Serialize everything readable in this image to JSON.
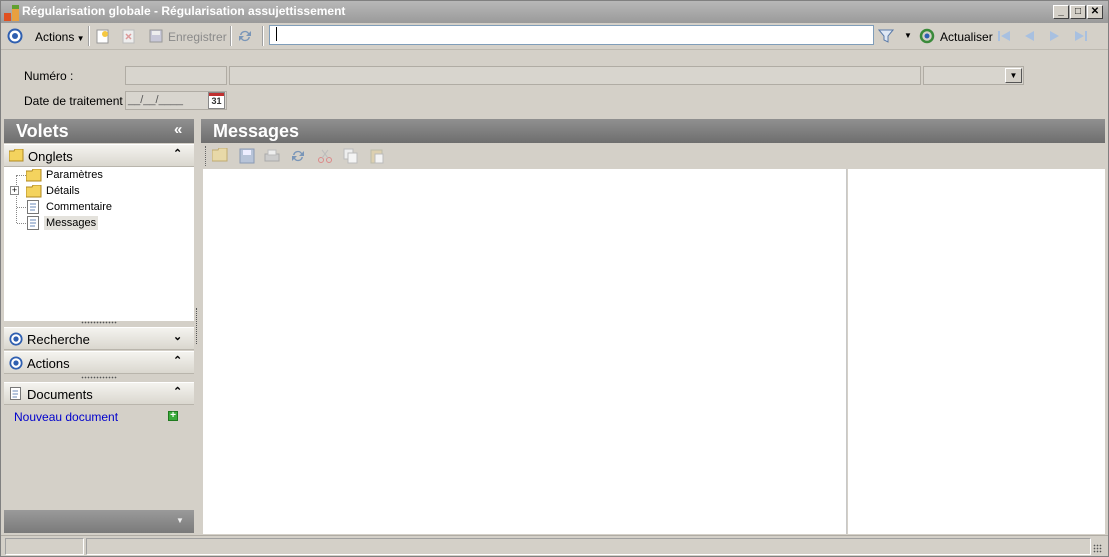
{
  "window": {
    "title": "Régularisation globale - Régularisation assujettissement",
    "controls": [
      "minimize",
      "maximize",
      "close"
    ]
  },
  "toolbar": {
    "actions_label": "Actions",
    "save_label": "Enregistrer",
    "search_value": "",
    "refresh_label": "Actualiser"
  },
  "form": {
    "numero_label": "Numéro :",
    "numero_value": "",
    "numero_desc": "",
    "numero_select": "",
    "date_label": "Date de traitement :",
    "date_placeholder": "__/__/____",
    "calendar_day": "31"
  },
  "left_pane": {
    "title": "Volets",
    "collapse_glyph": "«",
    "onglets": {
      "title": "Onglets",
      "items": [
        {
          "label": "Paramètres",
          "icon": "folder-icon"
        },
        {
          "label": "Détails",
          "icon": "folder-icon",
          "expandable": true
        },
        {
          "label": "Commentaire",
          "icon": "document-icon"
        },
        {
          "label": "Messages",
          "icon": "document-icon",
          "selected": true
        }
      ]
    },
    "recherche": {
      "title": "Recherche"
    },
    "actions": {
      "title": "Actions"
    },
    "documents": {
      "title": "Documents",
      "new_doc_label": "Nouveau document"
    }
  },
  "main_pane": {
    "title": "Messages"
  },
  "colors": {
    "title_bar": "#9a9a9a",
    "pane_header": "#7a7a7a",
    "link": "#0000cc",
    "background": "#d4d0c8"
  }
}
